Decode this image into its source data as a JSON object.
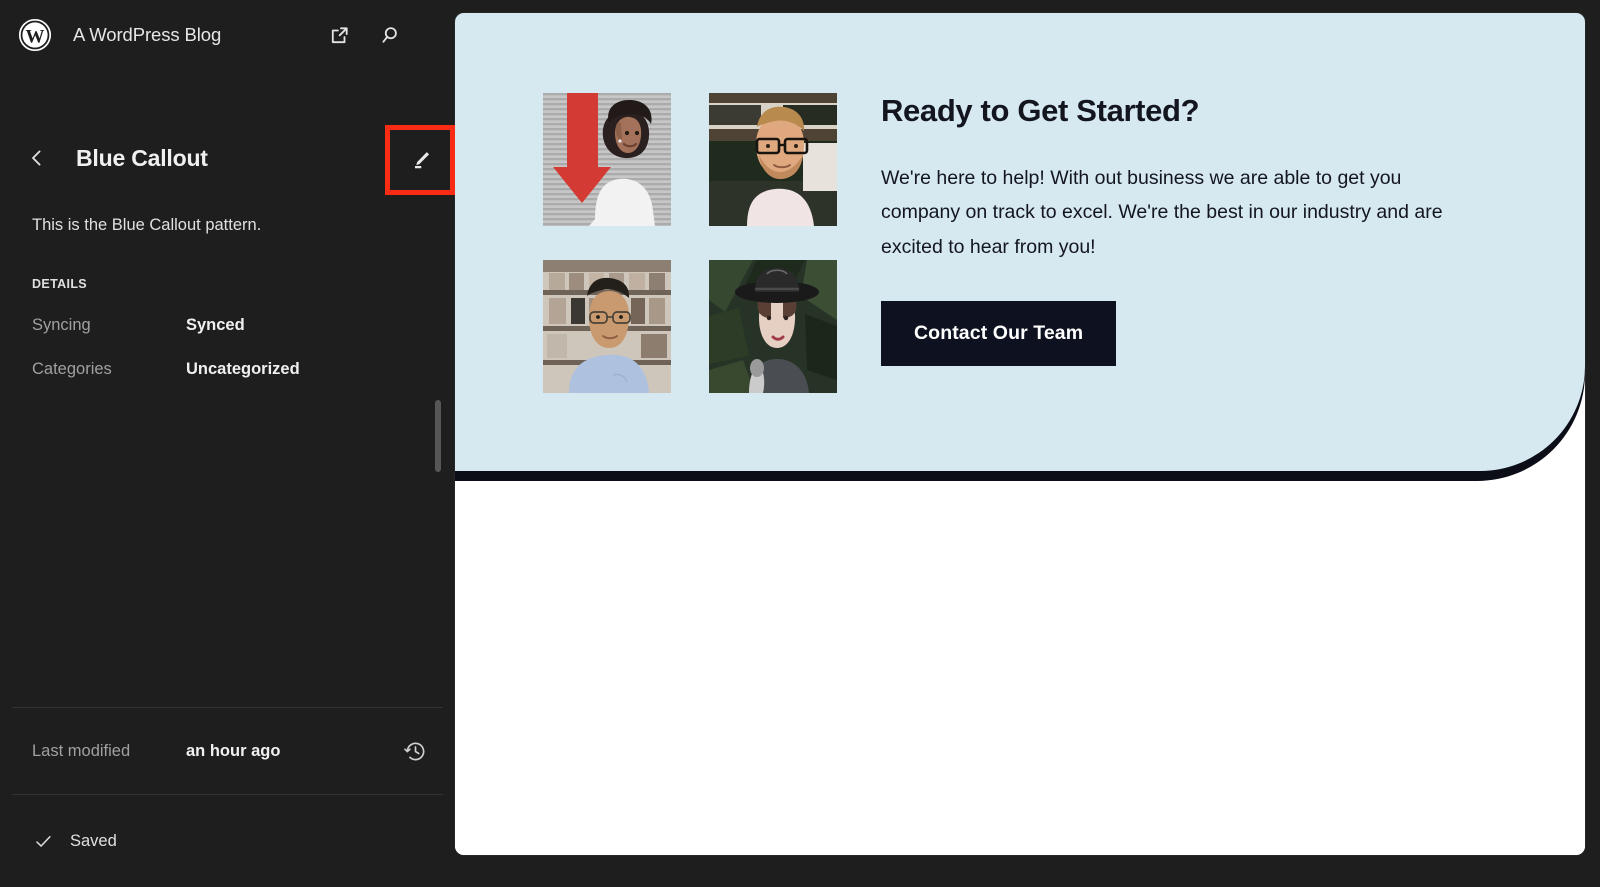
{
  "sidebar": {
    "header": {
      "logo_icon": "wordpress-logo-icon",
      "site_title": "A WordPress Blog",
      "view_site_icon": "external-link-icon",
      "search_icon": "search-icon"
    },
    "back_icon": "chevron-left-icon",
    "pattern_title": "Blue Callout",
    "edit_icon": "pencil-edit-icon",
    "pattern_description": "This is the Blue Callout pattern.",
    "details": {
      "section_label": "DETAILS",
      "rows": [
        {
          "key": "Syncing",
          "value": "Synced"
        },
        {
          "key": "Categories",
          "value": "Uncategorized"
        }
      ]
    },
    "last_modified": {
      "key": "Last modified",
      "value": "an hour ago",
      "history_icon": "revision-history-icon"
    },
    "status": {
      "check_icon": "checkmark-icon",
      "label": "Saved"
    }
  },
  "canvas": {
    "callout": {
      "background_color": "#d6e8f0",
      "heading": "Ready to Get Started?",
      "body": "We're here to help! With out business we are able to get you company on track to excel. We're the best in our industry and are excited to hear from you!",
      "cta_label": "Contact Our Team",
      "cta_background_color": "#0d1120",
      "photos": [
        {
          "alt": "Woman with afro in white jacket in front of red arrow"
        },
        {
          "alt": "Bearded man with glasses in pink shirt"
        },
        {
          "alt": "Man with glasses in blue sweatshirt in a shop"
        },
        {
          "alt": "Woman with wide-brim hat against green leaves"
        }
      ]
    }
  },
  "annotation": {
    "highlight_color": "#fa2d14",
    "target": "edit-pattern-button"
  }
}
